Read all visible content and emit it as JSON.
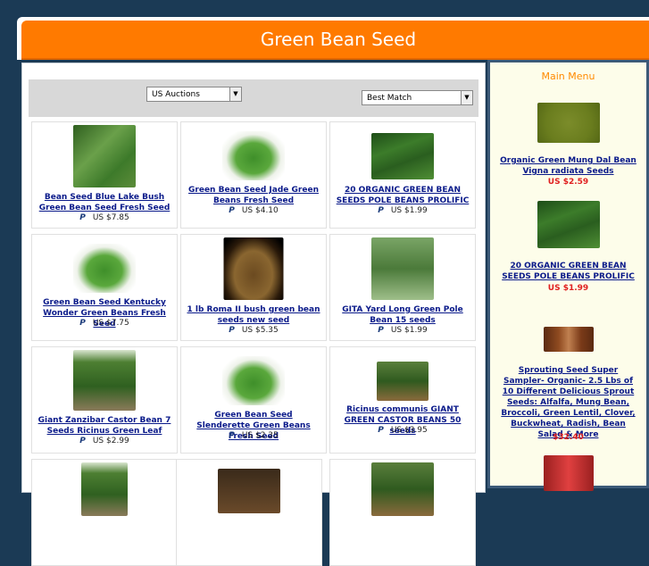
{
  "header": {
    "title": "Green Bean Seed"
  },
  "toolbar": {
    "auctions_select": "US Auctions",
    "sort_select": "Best Match"
  },
  "products": [
    {
      "title": "Bean Seed Blue Lake Bush Green Bean Seed Fresh Seed",
      "price": "US $7.85"
    },
    {
      "title": "Green Bean Seed Jade Green Beans Fresh Seed",
      "price": "US $4.10"
    },
    {
      "title": "20 ORGANIC GREEN BEAN SEEDS POLE BEANS PROLIFIC",
      "price": "US $1.99"
    },
    {
      "title": "Green Bean Seed Kentucky Wonder Green Beans Fresh Seed",
      "price": "US $7.75"
    },
    {
      "title": "1 lb Roma II bush green bean seeds new seed",
      "price": "US $5.35"
    },
    {
      "title": "GITA Yard Long Green Pole Bean 15 seeds",
      "price": "US $1.99"
    },
    {
      "title": "Giant Zanzibar Castor Bean 7 Seeds Ricinus Green Leaf",
      "price": "US $2.99"
    },
    {
      "title": "Green Bean Seed Slenderette Green Beans Fresh Seed",
      "price": "US $2.35"
    },
    {
      "title": "Ricinus communis GIANT GREEN CASTOR BEANS 50 seeds",
      "price": "US $3.95"
    }
  ],
  "paypal_label": "P",
  "sidebar": {
    "heading": "Main Menu",
    "items": [
      {
        "title": "Organic Green Mung Dal Bean Vigna radiata Seeds",
        "price": "US $2.59"
      },
      {
        "title": "20 ORGANIC GREEN BEAN SEEDS POLE BEANS PROLIFIC",
        "price": "US $1.99"
      },
      {
        "title": "Sprouting Seed Super Sampler- Organic- 2.5 Lbs of 10 Different Delicious Sprout Seeds: Alfalfa, Mung Bean, Broccoli, Green Lentil, Clover, Buckwheat, Radish, Bean Salad & More",
        "price": "$32.40"
      }
    ]
  },
  "colors": {
    "header_orange": "#ff7a00",
    "link_blue": "#0a1a8a",
    "price_red": "#e02020",
    "menu_orange": "#ff8a00",
    "page_navy": "#1b3a55"
  }
}
